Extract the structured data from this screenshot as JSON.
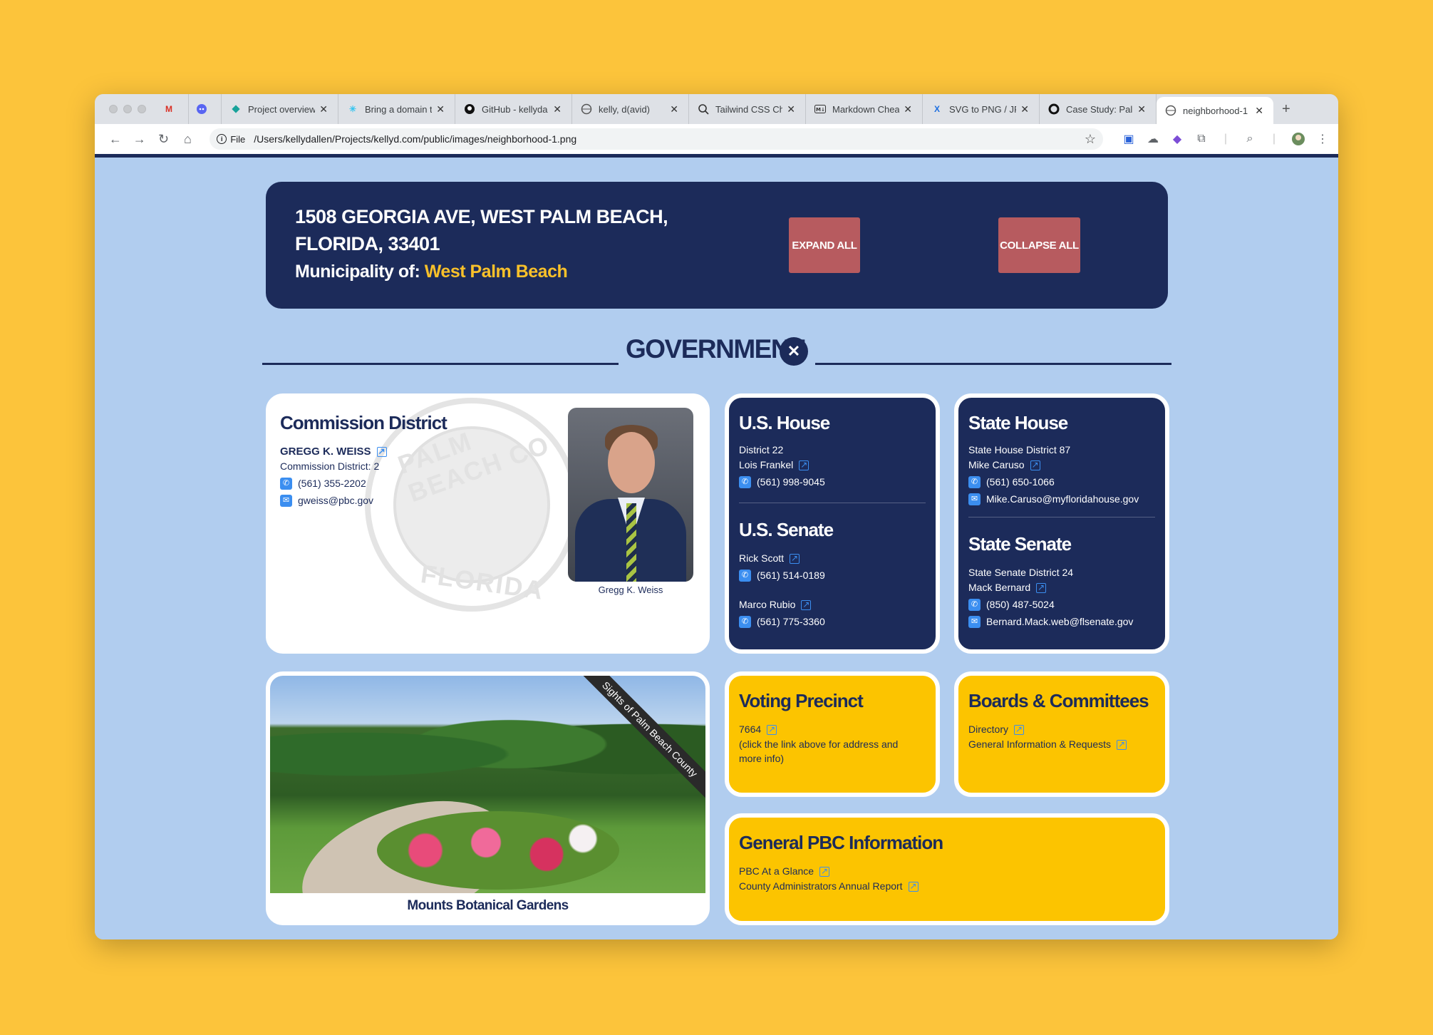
{
  "tabs": [
    {
      "icon": "M",
      "label": ""
    },
    {
      "icon": "discord",
      "label": ""
    },
    {
      "icon": "diamond",
      "label": "Project overview"
    },
    {
      "icon": "slack",
      "label": "Bring a domain t"
    },
    {
      "icon": "github",
      "label": "GitHub - kellyda"
    },
    {
      "icon": "globe",
      "label": "kelly, d(avid)"
    },
    {
      "icon": "search",
      "label": "Tailwind CSS Ch"
    },
    {
      "icon": "md",
      "label": "Markdown Chea"
    },
    {
      "icon": "X",
      "label": "SVG to PNG / JP"
    },
    {
      "icon": "circle",
      "label": "Case Study: Pal"
    },
    {
      "icon": "globe",
      "label": "neighborhood-1"
    }
  ],
  "address_bar": {
    "chip": "File",
    "url": "/Users/kellydallen/Projects/kellyd.com/public/images/neighborhood-1.png"
  },
  "header": {
    "address": "1508 GEORGIA AVE, WEST PALM BEACH, FLORIDA, 33401",
    "municipality_label": "Municipality of:",
    "municipality": "West Palm Beach",
    "expand_label": "EXPAND ALL",
    "collapse_label": "COLLAPSE ALL"
  },
  "section": {
    "title": "GOVERNMENT"
  },
  "commission": {
    "title": "Commission District",
    "name": "GREGG K. WEISS",
    "district": "Commission District: 2",
    "phone": "(561) 355-2202",
    "email": "gweiss@pbc.gov",
    "photo_caption": "Gregg K. Weiss",
    "seal_top": "PALM BEACH CO",
    "seal_bottom": "FLORIDA"
  },
  "us_house": {
    "title": "U.S. House",
    "district": "District 22",
    "name": "Lois Frankel",
    "phone": "(561) 998-9045"
  },
  "us_senate": {
    "title": "U.S. Senate",
    "senators": [
      {
        "name": "Rick Scott",
        "phone": "(561) 514-0189"
      },
      {
        "name": "Marco Rubio",
        "phone": "(561) 775-3360"
      }
    ]
  },
  "state_house": {
    "title": "State House",
    "district": "State House District 87",
    "name": "Mike Caruso",
    "phone": "(561) 650-1066",
    "email": "Mike.Caruso@myfloridahouse.gov"
  },
  "state_senate": {
    "title": "State Senate",
    "district": "State Senate District 24",
    "name": "Mack Bernard",
    "phone": "(850) 487-5024",
    "email": "Bernard.Mack.web@flsenate.gov"
  },
  "garden": {
    "ribbon": "Sights of Palm Beach County",
    "caption": "Mounts Botanical Gardens"
  },
  "voting": {
    "title": "Voting Precinct",
    "precinct": "7664",
    "note": "(click the link above for address and more info)"
  },
  "boards": {
    "title": "Boards & Committees",
    "links": [
      "Directory",
      "General Information & Requests"
    ]
  },
  "pbc": {
    "title": "General PBC Information",
    "links": [
      "PBC At a Glance",
      "County Administrators Annual Report"
    ]
  },
  "colors": {
    "navy": "#1c2b5a",
    "yellow": "#fcc400",
    "gold_text": "#f9c12a",
    "button_red": "#b75b5f",
    "page_bg": "#b1cdef",
    "outer_bg": "#fcc43b"
  }
}
